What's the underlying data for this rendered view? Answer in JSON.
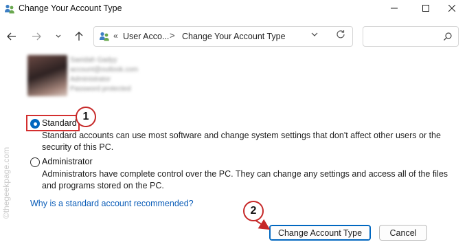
{
  "window": {
    "title": "Change Your Account Type",
    "controls": {
      "minimize": "—",
      "maximize": "☐",
      "close": "✕"
    }
  },
  "nav": {
    "back_icon": "arrow-left-icon",
    "forward_icon": "arrow-right-icon",
    "recent_icon": "chevron-down-icon",
    "up_icon": "arrow-up-icon",
    "address": {
      "overflow": "«",
      "crumb_parent": "User Acco...",
      "separator": ">",
      "crumb_current": "Change Your Account Type"
    },
    "search_placeholder": ""
  },
  "user_card": {
    "lines": [
      "Saeidah Gadyy",
      "account@outlook.com",
      "Administrator",
      "Password protected"
    ]
  },
  "options": {
    "standard": {
      "label": "Standard",
      "selected": true,
      "description_line1": "Standard accounts can use most software and change system settings that don't affect other users or the",
      "description_line2": "security of this PC."
    },
    "administrator": {
      "label": "Administrator",
      "selected": false,
      "description_line1": "Administrators have complete control over the PC. They can change any settings and access all of the files",
      "description_line2": "and programs stored on the PC."
    }
  },
  "help_link": "Why is a standard account recommended?",
  "buttons": {
    "change": "Change Account Type",
    "cancel": "Cancel"
  },
  "annotations": {
    "step1": "1",
    "step2": "2",
    "highlight_color": "#d32f2f"
  },
  "watermark": "©thegeekpage.com",
  "colors": {
    "accent": "#0067c0",
    "link": "#0b5db8",
    "annotation": "#c62828"
  }
}
